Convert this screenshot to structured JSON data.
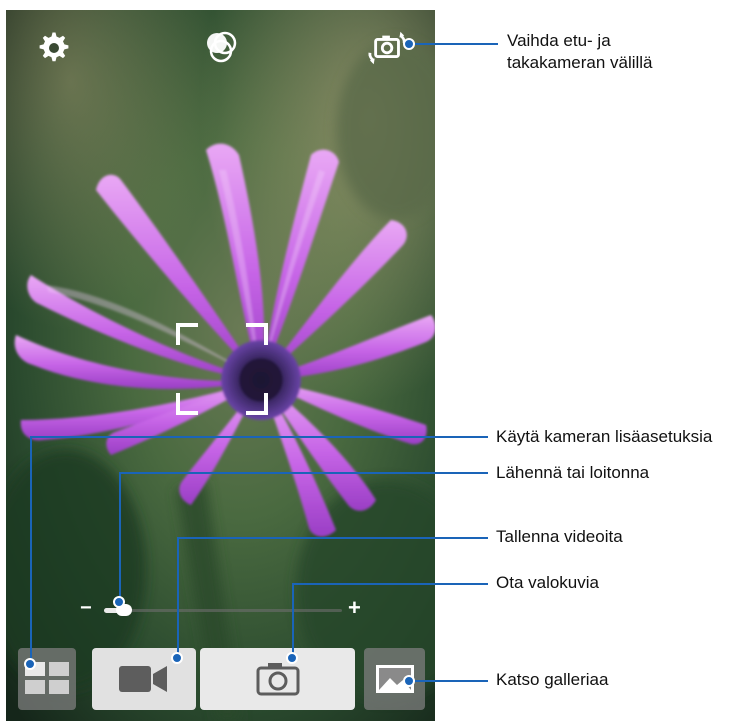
{
  "callouts": {
    "switch_camera": "Vaihda etu- ja\ntakakameran välillä",
    "advanced_settings": "Käytä kameran lisäasetuksia",
    "zoom": "Lähennä tai loitonna",
    "record_video": "Tallenna videoita",
    "take_photo": "Ota valokuvia",
    "gallery": "Katso galleriaa"
  },
  "zoom": {
    "minus": "−",
    "plus": "+",
    "level": 0.08
  },
  "icons": {
    "settings": "gear-icon",
    "effects": "effects-icon",
    "switch": "switch-camera-icon",
    "modes": "camera-modes-icon",
    "video": "video-camera-icon",
    "shutter": "camera-icon",
    "gallery": "gallery-icon"
  },
  "colors": {
    "callout_line": "#1a64b8",
    "petal": "#c65ee6",
    "background": "#2a4a30"
  }
}
